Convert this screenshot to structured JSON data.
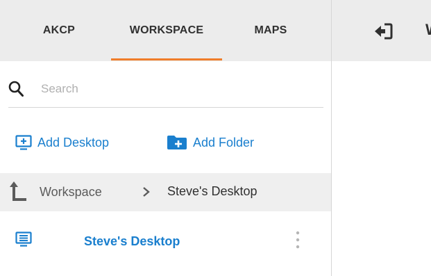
{
  "tabs": {
    "akcp": "AKCP",
    "workspace": "WORKSPACE",
    "maps": "MAPS",
    "active": "WORKSPACE"
  },
  "search": {
    "placeholder": "Search",
    "value": ""
  },
  "actions": {
    "add_desktop": "Add Desktop",
    "add_folder": "Add Folder"
  },
  "breadcrumb": {
    "root": "Workspace",
    "current": "Steve's Desktop"
  },
  "list": {
    "items": [
      {
        "label": "Steve's Desktop",
        "icon": "desktop-icon"
      }
    ]
  },
  "right_header": {
    "title": "W"
  },
  "colors": {
    "accent_blue": "#1a7fce",
    "tab_underline": "#f07d2a",
    "header_bg": "#ececec"
  }
}
